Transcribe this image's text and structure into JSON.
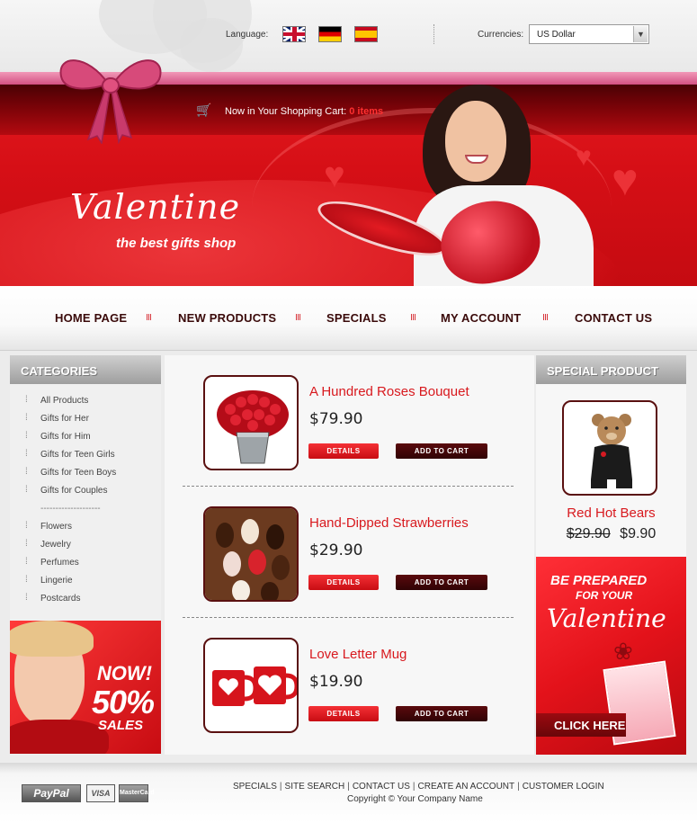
{
  "header": {
    "language_label": "Language:",
    "currencies_label": "Currencies:",
    "currency_selected": "US Dollar",
    "flags": [
      {
        "icon": "uk-flag-icon"
      },
      {
        "icon": "germany-flag-icon"
      },
      {
        "icon": "spain-flag-icon"
      }
    ]
  },
  "banner": {
    "cart_text": "Now in Your Shopping Cart:",
    "cart_count": "0 items",
    "title": "Valentine",
    "subtitle": "the best gifts shop"
  },
  "nav": {
    "items": [
      "HOME PAGE",
      "NEW PRODUCTS",
      "SPECIALS",
      "MY ACCOUNT",
      "CONTACT US"
    ]
  },
  "categories": {
    "title": "CATEGORIES",
    "group1": [
      "All Products",
      "Gifts for Her",
      "Gifts for Him",
      "Gifts for Teen Girls",
      "Gifts for Teen Boys",
      "Gifts for Couples"
    ],
    "separator": "--------------------",
    "group2": [
      "Flowers",
      "Jewelry",
      "Perfumes",
      "Lingerie",
      "Postcards"
    ]
  },
  "left_ad": {
    "line1": "NOW!",
    "line2": "50%",
    "line3": "SALES"
  },
  "products": [
    {
      "name": "A Hundred Roses Bouquet",
      "price": "$79.90",
      "details": "DETAILS",
      "cart": "ADD TO CART"
    },
    {
      "name": "Hand-Dipped Strawberries",
      "price": "$29.90",
      "details": "DETAILS",
      "cart": "ADD TO CART"
    },
    {
      "name": "Love Letter Mug",
      "price": "$19.90",
      "details": "DETAILS",
      "cart": "ADD TO CART"
    }
  ],
  "special": {
    "title": "SPECIAL PRODUCT",
    "name": "Red Hot Bears",
    "old_price": "$29.90",
    "new_price": "$9.90"
  },
  "right_ad": {
    "line1": "BE PREPARED",
    "line2": "FOR YOUR",
    "line3": "Valentine",
    "button": "CLICK HERE"
  },
  "footer": {
    "payments": [
      "PayPal",
      "VISA",
      "MasterCard"
    ],
    "links": [
      "SPECIALS",
      "SITE SEARCH",
      "CONTACT US",
      "CREATE AN ACCOUNT",
      "CUSTOMER LOGIN"
    ],
    "copyright": "Copyright © Your Company Name"
  },
  "colors": {
    "brand_red": "#d8191e",
    "dark_maroon": "#3a0a0a",
    "pink_ribbon": "#e0507f"
  }
}
